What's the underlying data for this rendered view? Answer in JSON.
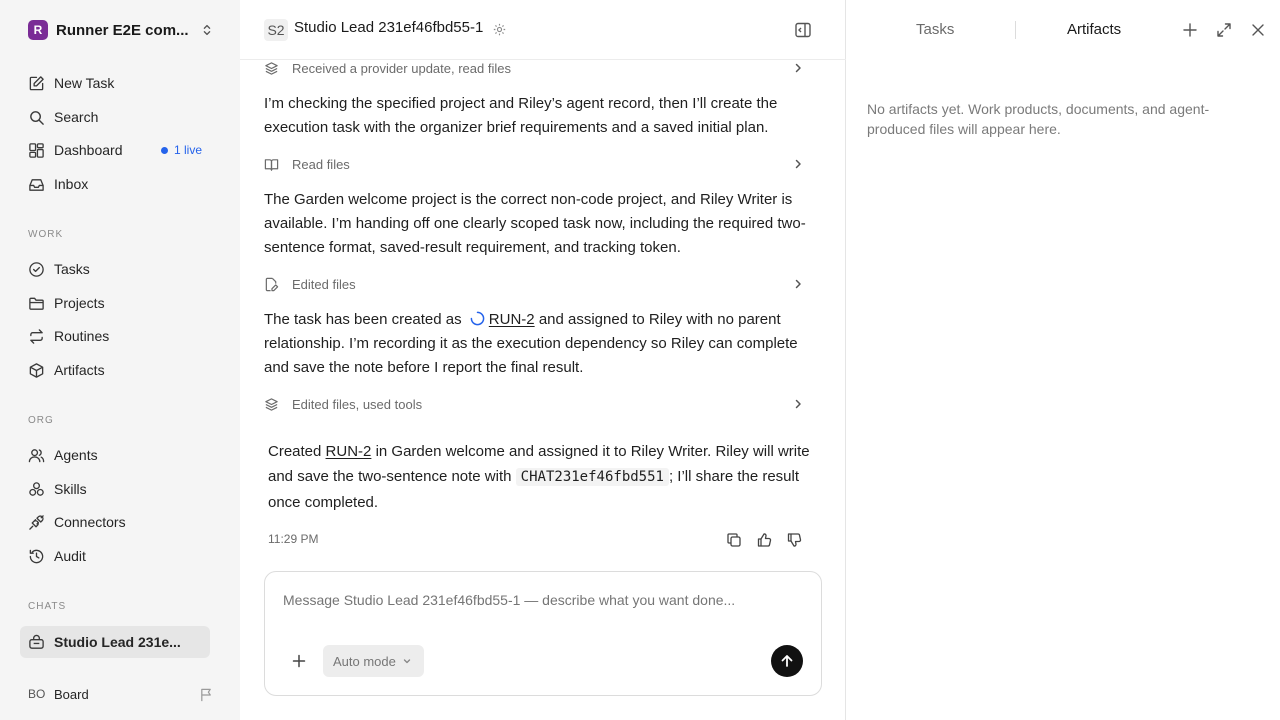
{
  "sidebar": {
    "workspace": {
      "logo": "R",
      "name": "Runner E2E com...",
      "switch_icon": "chevron-up-down-icon"
    },
    "primary": [
      {
        "label": "New Task",
        "icon": "edit-icon"
      },
      {
        "label": "Search",
        "icon": "search-icon"
      },
      {
        "label": "Dashboard",
        "icon": "dashboard-icon",
        "badge": "1 live"
      },
      {
        "label": "Inbox",
        "icon": "inbox-icon"
      }
    ],
    "sections": {
      "work": "WORK",
      "org": "ORG",
      "chats": "CHATS"
    },
    "work": [
      {
        "label": "Tasks",
        "icon": "check-circle-icon"
      },
      {
        "label": "Projects",
        "icon": "folder-icon"
      },
      {
        "label": "Routines",
        "icon": "repeat-icon"
      },
      {
        "label": "Artifacts",
        "icon": "cube-icon"
      }
    ],
    "org": [
      {
        "label": "Agents",
        "icon": "users-icon"
      },
      {
        "label": "Skills",
        "icon": "skills-icon"
      },
      {
        "label": "Connectors",
        "icon": "plug-icon"
      },
      {
        "label": "Audit",
        "icon": "history-icon"
      }
    ],
    "chats": [
      {
        "label": "Studio Lead 231e...",
        "icon": "chat-icon",
        "active": true
      }
    ],
    "footer": {
      "avatar": "BO",
      "name": "Board",
      "icon": "flag-icon"
    }
  },
  "header": {
    "badge": "S2",
    "title": "Studio Lead 231ef46fbd55-1"
  },
  "conversation": {
    "tool1": "Received a provider update, read files",
    "para1": "I’m checking the specified project and Riley’s agent record, then I’ll create the execution task with the organizer brief requirements and a saved initial plan.",
    "tool2": "Read files",
    "para2": "The Garden welcome project is the correct non-code project, and Riley Writer is available. I’m handing off one clearly scoped task now, including the required two-sentence format, saved-result requirement, and tracking token.",
    "tool3": "Edited files",
    "para3_a": "The task has been created as",
    "para3_link": "RUN-2",
    "para3_b": "and assigned to Riley with no parent relationship. I’m recording it as the execution dependency so Riley can complete and save the note before I report the final result.",
    "tool4": "Edited files, used tools",
    "final_a": "Created",
    "final_link": "RUN-2",
    "final_b": "in Garden welcome and assigned it to Riley Writer. Riley will write and save the two-sentence note with",
    "final_code": "CHAT231ef46fbd551",
    "final_c": "; I’ll share the result once completed.",
    "time": "11:29 PM"
  },
  "composer": {
    "placeholder": "Message Studio Lead 231ef46fbd55-1 — describe what you want done...",
    "mode": "Auto mode"
  },
  "right_panel": {
    "tabs": [
      "Tasks",
      "Artifacts"
    ],
    "active_tab": "Artifacts",
    "empty": "No artifacts yet. Work products, documents, and agent-produced files will appear here."
  }
}
